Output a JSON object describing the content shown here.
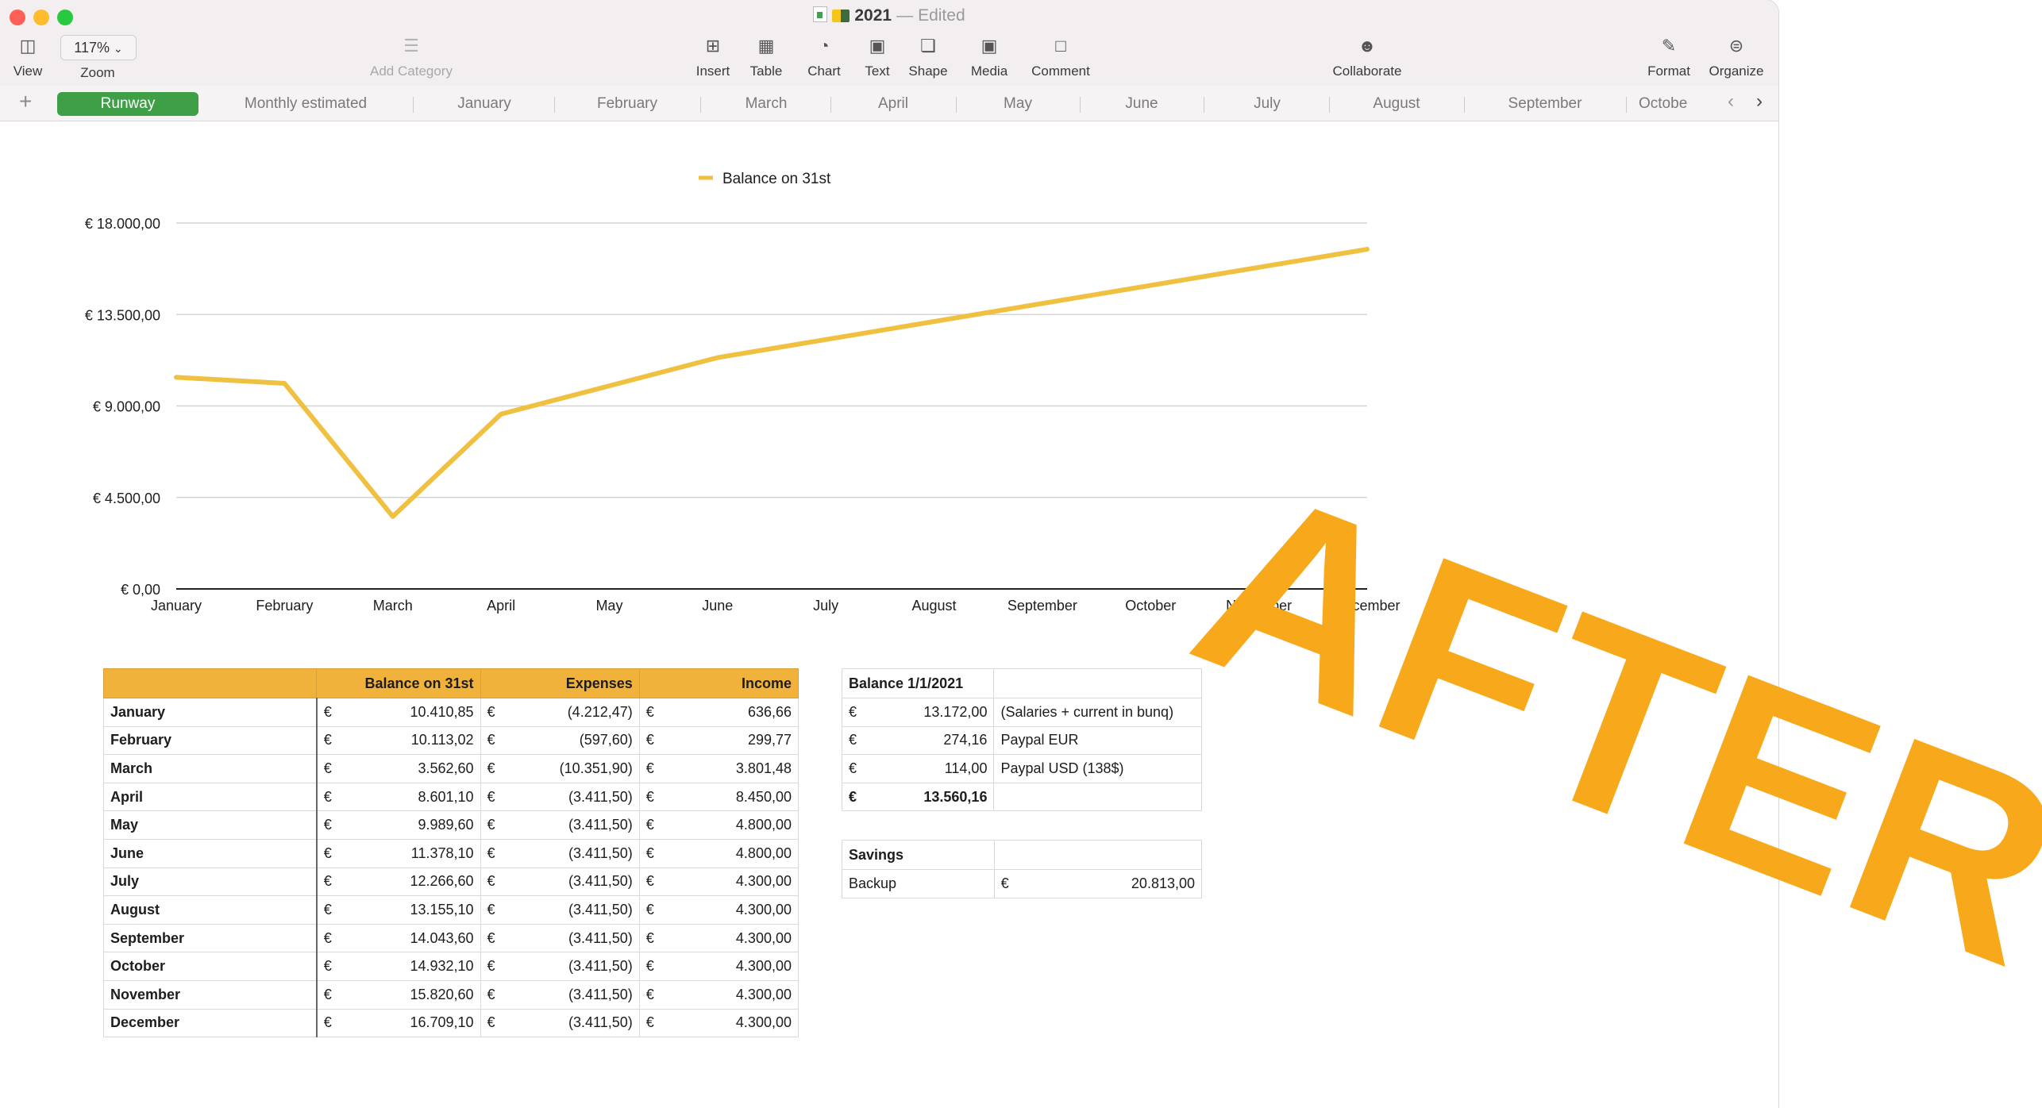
{
  "window": {
    "title": "2021",
    "title_separator": "—",
    "status": "Edited"
  },
  "toolbar": {
    "view": {
      "label": "View",
      "icon": "sidebar-icon"
    },
    "zoom": {
      "value": "117%",
      "label": "Zoom"
    },
    "add_category": {
      "label": "Add Category",
      "icon": "list-icon"
    },
    "insert": {
      "label": "Insert",
      "icon": "insert-icon"
    },
    "table": {
      "label": "Table",
      "icon": "table-icon"
    },
    "chart": {
      "label": "Chart",
      "icon": "chart-icon"
    },
    "text": {
      "label": "Text",
      "icon": "text-icon"
    },
    "shape": {
      "label": "Shape",
      "icon": "shape-icon"
    },
    "media": {
      "label": "Media",
      "icon": "media-icon"
    },
    "comment": {
      "label": "Comment",
      "icon": "comment-icon"
    },
    "collaborate": {
      "label": "Collaborate",
      "icon": "collaborate-icon"
    },
    "format": {
      "label": "Format",
      "icon": "paintbrush-icon"
    },
    "organize": {
      "label": "Organize",
      "icon": "organize-icon"
    }
  },
  "tabs": [
    "Runway",
    "Monthly estimated",
    "January",
    "February",
    "March",
    "April",
    "May",
    "June",
    "July",
    "August",
    "September",
    "Octobe"
  ],
  "active_tab": "Runway",
  "chart_data": {
    "type": "line",
    "legend": "top-center",
    "categories": [
      "January",
      "February",
      "March",
      "April",
      "May",
      "June",
      "July",
      "August",
      "September",
      "October",
      "November",
      "December"
    ],
    "series": [
      {
        "name": "Balance on 31st",
        "color": "#f0c040",
        "values": [
          10410.85,
          10113.02,
          3562.6,
          8601.1,
          9989.6,
          11378.1,
          12266.6,
          13155.1,
          14043.6,
          14932.1,
          15820.6,
          16709.1
        ]
      }
    ],
    "ylim": [
      0,
      18000
    ],
    "yticks": [
      0,
      4500,
      9000,
      13500,
      18000
    ],
    "ytick_labels": [
      "€ 0,00",
      "€ 4.500,00",
      "€ 9.000,00",
      "€ 13.500,00",
      "€ 18.000,00"
    ],
    "grid": true
  },
  "runway_table": {
    "headers": [
      "",
      "Balance on 31st",
      "Expenses",
      "Income"
    ],
    "currency": "€",
    "rows": [
      {
        "month": "January",
        "balance": "10.410,85",
        "expenses": "(4.212,47)",
        "income": "636,66"
      },
      {
        "month": "February",
        "balance": "10.113,02",
        "expenses": "(597,60)",
        "income": "299,77"
      },
      {
        "month": "March",
        "balance": "3.562,60",
        "expenses": "(10.351,90)",
        "income": "3.801,48"
      },
      {
        "month": "April",
        "balance": "8.601,10",
        "expenses": "(3.411,50)",
        "income": "8.450,00"
      },
      {
        "month": "May",
        "balance": "9.989,60",
        "expenses": "(3.411,50)",
        "income": "4.800,00"
      },
      {
        "month": "June",
        "balance": "11.378,10",
        "expenses": "(3.411,50)",
        "income": "4.800,00"
      },
      {
        "month": "July",
        "balance": "12.266,60",
        "expenses": "(3.411,50)",
        "income": "4.300,00"
      },
      {
        "month": "August",
        "balance": "13.155,10",
        "expenses": "(3.411,50)",
        "income": "4.300,00"
      },
      {
        "month": "September",
        "balance": "14.043,60",
        "expenses": "(3.411,50)",
        "income": "4.300,00"
      },
      {
        "month": "October",
        "balance": "14.932,10",
        "expenses": "(3.411,50)",
        "income": "4.300,00"
      },
      {
        "month": "November",
        "balance": "15.820,60",
        "expenses": "(3.411,50)",
        "income": "4.300,00"
      },
      {
        "month": "December",
        "balance": "16.709,10",
        "expenses": "(3.411,50)",
        "income": "4.300,00"
      }
    ]
  },
  "balance_table": {
    "header": "Balance 1/1/2021",
    "rows": [
      {
        "currency": "€",
        "value": "13.172,00",
        "note": "(Salaries + current in bunq)"
      },
      {
        "currency": "€",
        "value": "274,16",
        "note": "Paypal EUR"
      },
      {
        "currency": "€",
        "value": "114,00",
        "note": "Paypal USD (138$)"
      }
    ],
    "total": {
      "currency": "€",
      "value": "13.560,16"
    }
  },
  "savings_table": {
    "header": "Savings",
    "rows": [
      {
        "label": "Backup",
        "currency": "€",
        "value": "20.813,00"
      }
    ]
  },
  "overlay": {
    "text": "AFTER",
    "color": "#f7a81b"
  }
}
